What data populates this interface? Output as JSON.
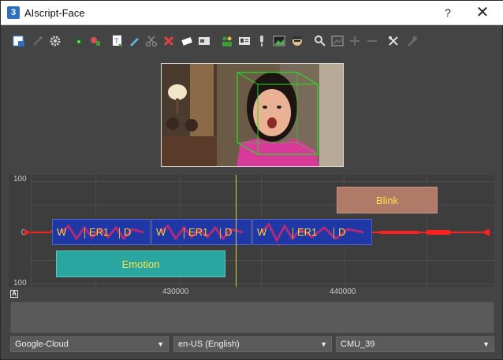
{
  "window": {
    "app_icon_glyph": "3",
    "title": "AIscript-Face",
    "help_label": "?",
    "close_label": "✕"
  },
  "toolbar": {
    "buttons": [
      {
        "name": "export-icon",
        "color": "#5aa0e6"
      },
      {
        "name": "wand-icon",
        "color": "#6a6a6a"
      },
      {
        "name": "gear-icon",
        "color": "#d8d8d8"
      },
      {
        "name": "eye-icon",
        "color": "#3c8c3c"
      },
      {
        "name": "face-paint-icon",
        "color": "#d85050"
      },
      {
        "name": "text-file-icon",
        "color": "#ffffff"
      },
      {
        "name": "pen-icon",
        "color": "#60b0e0"
      },
      {
        "name": "scissors-icon",
        "color": "#888888"
      },
      {
        "name": "delete-icon",
        "color": "#e04040"
      },
      {
        "name": "erase-icon",
        "color": "#ffffff"
      },
      {
        "name": "text-box-icon",
        "color": "#e0e0e0"
      },
      {
        "name": "people-icon",
        "color": "#3c9c3c"
      },
      {
        "name": "id-card-icon",
        "color": "#e0e0e0"
      },
      {
        "name": "microphone-icon",
        "color": "#cfcfcf"
      },
      {
        "name": "picture-icon",
        "color": "#4caf50"
      },
      {
        "name": "avatar-icon",
        "color": "#e0c090"
      },
      {
        "name": "search-face-icon",
        "color": "#dddddd"
      },
      {
        "name": "image-icon",
        "color": "#888888"
      },
      {
        "name": "plus-icon",
        "color": "#6a6a6a"
      },
      {
        "name": "minus-icon",
        "color": "#6a6a6a"
      },
      {
        "name": "tools-icon",
        "color": "#dddddd"
      },
      {
        "name": "wrench-icon",
        "color": "#6a6a6a"
      }
    ]
  },
  "timeline": {
    "y_ticks": [
      "100",
      "0",
      "100"
    ],
    "x_ticks": [
      "430000",
      "440000"
    ],
    "blink_label": "Blink",
    "emotion_label": "Emotion",
    "phoneme_groups": [
      [
        "W",
        "ER1",
        "D"
      ],
      [
        "W",
        "ER1",
        "D"
      ],
      [
        "W",
        "ER1",
        "D"
      ]
    ],
    "marker_label": "A"
  },
  "bottom": {
    "engine": "Google-Cloud",
    "language": "en-US (English)",
    "model": "CMU_39"
  }
}
